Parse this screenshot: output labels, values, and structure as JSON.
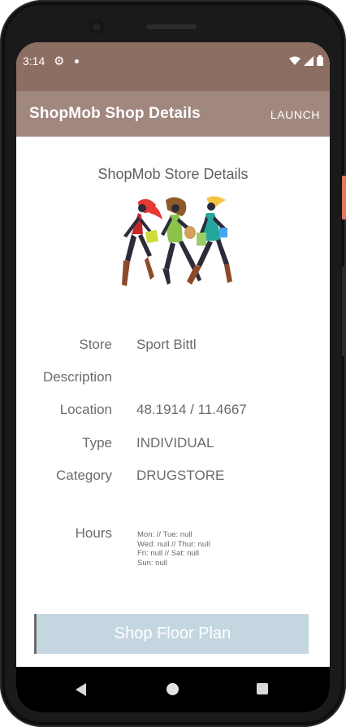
{
  "status_bar": {
    "time": "3:14",
    "icons": [
      "gear-icon",
      "notification-dot-icon",
      "wifi-icon",
      "signal-icon",
      "battery-icon"
    ]
  },
  "app_bar": {
    "title": "ShopMob Shop Details",
    "action_label": "LAUNCH"
  },
  "content": {
    "heading": "ShopMob Store Details",
    "image": "shoppers-illustration",
    "details": {
      "store_label": "Store",
      "store_value": "Sport Bittl",
      "description_label": "Description",
      "description_value": "",
      "location_label": "Location",
      "location_value": "48.1914 / 11.4667",
      "type_label": "Type",
      "type_value": "INDIVIDUAL",
      "category_label": "Category",
      "category_value": "DRUGSTORE",
      "hours_label": "Hours",
      "hours_lines": [
        "Mon:  // Tue: null",
        "Wed: null // Thur: null",
        "Fri: null // Sat: null",
        "Sun: null"
      ]
    },
    "floor_plan_button": "Shop Floor Plan"
  },
  "nav_bar": {
    "icons": [
      "back-icon",
      "home-icon",
      "recents-icon"
    ]
  },
  "colors": {
    "status_bar": "#8d6e63",
    "app_bar": "#a1887f",
    "button": "#c4d7e0",
    "text": "#6b6b6b"
  }
}
